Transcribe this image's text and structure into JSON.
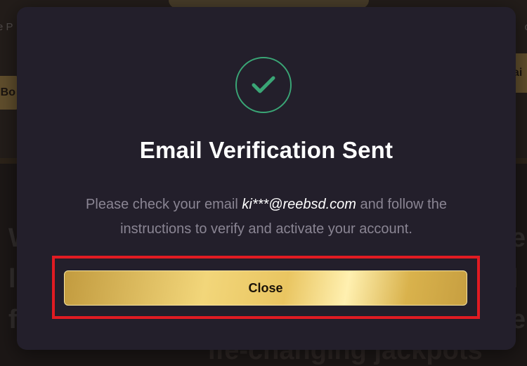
{
  "background": {
    "left_text": "e P",
    "right_text": "c",
    "left_button": "Bo",
    "right_button": "ai",
    "side_left": "W\nl\nf",
    "side_right": "e\nl\ne",
    "heading_fragment": "ife-changing jackpots"
  },
  "modal": {
    "icon": "checkmark-icon",
    "title": "Email Verification Sent",
    "message_before": "Please check your email ",
    "email": "ki***@reebsd.com",
    "message_after": " and follow the instructions to verify and activate your account.",
    "close_label": "Close"
  },
  "colors": {
    "accent_green": "#3aa676",
    "highlight_red": "#e11b22",
    "gold": "#e9c561"
  }
}
